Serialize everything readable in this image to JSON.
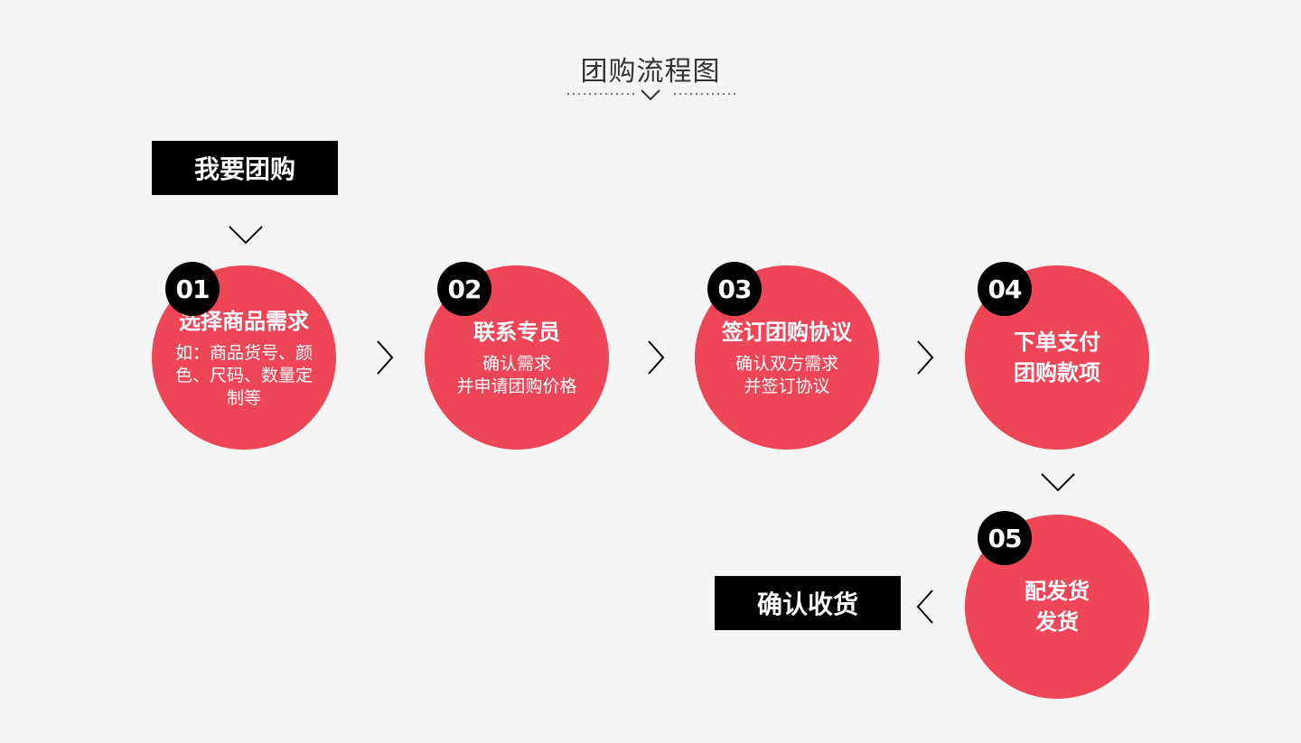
{
  "title": "团购流程图",
  "start": {
    "label": "我要团购"
  },
  "end": {
    "label": "确认收货"
  },
  "steps": [
    {
      "number": "01",
      "title": "选择商品需求",
      "desc": "如：商品货号、颜色、尺码、数量定制等"
    },
    {
      "number": "02",
      "title": "联系专员",
      "desc_lines": [
        "确认需求",
        "并申请团购价格"
      ]
    },
    {
      "number": "03",
      "title": "签订团购协议",
      "desc_lines": [
        "确认双方需求",
        "并签订协议"
      ]
    },
    {
      "number": "04",
      "title_lines": [
        "下单支付",
        "团购款项"
      ]
    },
    {
      "number": "05",
      "title_lines": [
        "配发货",
        "发货"
      ]
    }
  ],
  "colors": {
    "accent": "#ee4657",
    "dark": "#000000",
    "background": "#f5f5f5"
  },
  "icons": [
    "chevron-down-icon",
    "chevron-right-icon",
    "chevron-left-icon"
  ]
}
